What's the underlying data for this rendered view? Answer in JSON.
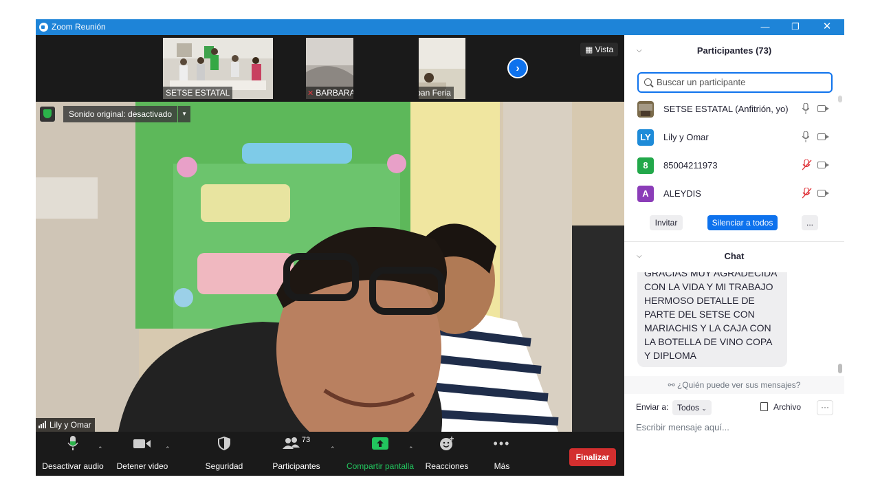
{
  "window": {
    "title": "Zoom Reunión"
  },
  "thumbs": [
    {
      "name": "SETSE ESTATAL",
      "muted": false
    },
    {
      "name": "BARBARA ME...",
      "muted": true
    },
    {
      "name": "Esteban Feria",
      "muted": true
    }
  ],
  "view_button": "Vista",
  "main_video": {
    "sound_label": "Sonido original: desactivado",
    "speaker_name": "Lily y Omar"
  },
  "toolbar": {
    "audio": "Desactivar audio",
    "video": "Detener video",
    "security": "Seguridad",
    "participants": "Participantes",
    "participants_count": "73",
    "share": "Compartir pantalla",
    "reactions": "Reacciones",
    "more": "Más",
    "end": "Finalizar"
  },
  "participants_panel": {
    "title": "Participantes (73)",
    "search_placeholder": "Buscar un participante",
    "list": [
      {
        "initials": "",
        "name": "SETSE ESTATAL (Anfitrión, yo)",
        "avatar_color": "#6b5a3a",
        "mic_muted": false
      },
      {
        "initials": "LY",
        "name": "Lily y Omar",
        "avatar_color": "#1e8bd8",
        "mic_muted": false
      },
      {
        "initials": "8",
        "name": "85004211973",
        "avatar_color": "#22a84a",
        "mic_muted": true
      },
      {
        "initials": "A",
        "name": "ALEYDIS",
        "avatar_color": "#8b3db8",
        "mic_muted": true
      }
    ],
    "invite": "Invitar",
    "mute_all": "Silenciar a todos",
    "more": "..."
  },
  "chat": {
    "title": "Chat",
    "message": "GRACIAS MUY AGRADECIDA CON LA VIDA Y MI TRABAJO HERMOSO DETALLE DE PARTE DEL SETSE CON MARIACHIS Y LA CAJA CON LA BOTELLA DE VINO COPA Y DIPLOMA",
    "who_can_see": "¿Quién puede ver sus mensajes?",
    "send_to_label": "Enviar a:",
    "send_to_value": "Todos",
    "file": "Archivo",
    "more": "···",
    "input_placeholder": "Escribir mensaje aquí..."
  },
  "colors": {
    "titlebar": "#1e84d8",
    "accent": "#0e72ed",
    "end_button": "#d32f2f",
    "share_green": "#22c55e",
    "dark_bg": "#1a1a1a"
  }
}
